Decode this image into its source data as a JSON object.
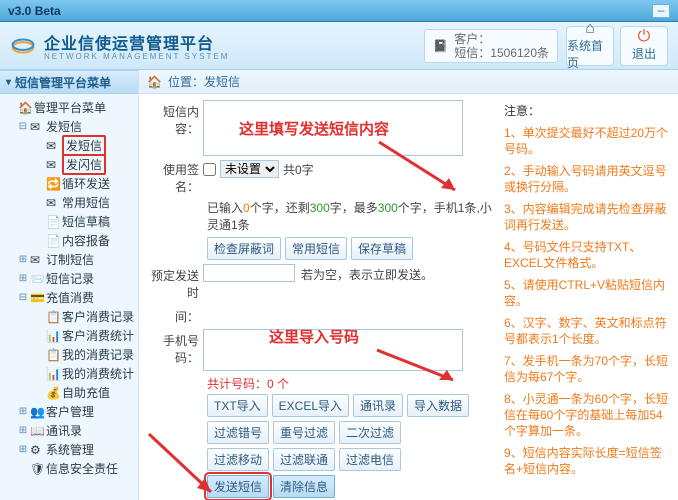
{
  "titlebar": {
    "version": "v3.0 Beta"
  },
  "header": {
    "brand": "企业信使运营管理平台",
    "brand_sub": "NETWORK  MANAGEMENT  SYSTEM",
    "cust_label": "客户：",
    "sms_label": "短信：1506120条",
    "home": "系统首页",
    "exit": "退出"
  },
  "side": {
    "title": "短信管理平台菜单",
    "nodes": [
      {
        "lvl": 0,
        "tg": "",
        "ic": "🏠",
        "lbl": "管理平台菜单"
      },
      {
        "lvl": 1,
        "tg": "⊟",
        "ic": "✉",
        "lbl": "发短信"
      },
      {
        "lvl": 2,
        "tg": "",
        "ic": "✉",
        "lbl": "发短信",
        "red": true,
        "name": "nav-send-sms"
      },
      {
        "lvl": 2,
        "tg": "",
        "ic": "✉",
        "lbl": "发闪信",
        "red": true,
        "name": "nav-send-flash"
      },
      {
        "lvl": 2,
        "tg": "",
        "ic": "🔁",
        "lbl": "循环发送"
      },
      {
        "lvl": 2,
        "tg": "",
        "ic": "✉",
        "lbl": "常用短信"
      },
      {
        "lvl": 2,
        "tg": "",
        "ic": "📄",
        "lbl": "短信草稿"
      },
      {
        "lvl": 2,
        "tg": "",
        "ic": "📄",
        "lbl": "内容报备"
      },
      {
        "lvl": 1,
        "tg": "⊞",
        "ic": "✉",
        "lbl": "订制短信"
      },
      {
        "lvl": 1,
        "tg": "⊞",
        "ic": "📨",
        "lbl": "短信记录"
      },
      {
        "lvl": 1,
        "tg": "⊟",
        "ic": "💳",
        "lbl": "充值消费"
      },
      {
        "lvl": 2,
        "tg": "",
        "ic": "📋",
        "lbl": "客户消费记录"
      },
      {
        "lvl": 2,
        "tg": "",
        "ic": "📊",
        "lbl": "客户消费统计"
      },
      {
        "lvl": 2,
        "tg": "",
        "ic": "📋",
        "lbl": "我的消费记录"
      },
      {
        "lvl": 2,
        "tg": "",
        "ic": "📊",
        "lbl": "我的消费统计"
      },
      {
        "lvl": 2,
        "tg": "",
        "ic": "💰",
        "lbl": "自助充值"
      },
      {
        "lvl": 1,
        "tg": "⊞",
        "ic": "👥",
        "lbl": "客户管理"
      },
      {
        "lvl": 1,
        "tg": "⊞",
        "ic": "📖",
        "lbl": "通讯录"
      },
      {
        "lvl": 1,
        "tg": "⊞",
        "ic": "⚙",
        "lbl": "系统管理"
      },
      {
        "lvl": 1,
        "tg": "",
        "ic": "🛡",
        "lbl": "信息安全责任"
      }
    ]
  },
  "crumb": {
    "icon": "🏠",
    "label": "位置：发短信"
  },
  "form": {
    "content_label": "短信内容：",
    "sig_label": "使用签名：",
    "sig_select": "未设置",
    "sig_count": "共0字",
    "typed_a": "已输入",
    "typed_b": "个字，还剩",
    "typed_c": "字，最多",
    "typed_d": "个字，手机1条,小灵通1条",
    "n0": "0",
    "n300a": "300",
    "n300b": "300",
    "btn_check": "检查屏蔽词",
    "btn_common": "常用短信",
    "btn_draft": "保存草稿",
    "sched_label": "预定发送时",
    "sched_tip": "若为空，表示立即发送。",
    "gap_label": "间：",
    "phone_label": "手机号码：",
    "count_label": "共计号码：0 个",
    "b_txt": "TXT导入",
    "b_excel": "EXCEL导入",
    "b_book": "通讯录",
    "b_data": "导入数据",
    "b_ferr": "过滤错号",
    "b_fdup": "重号过滤",
    "b_f2": "二次过滤",
    "b_fmob": "过滤移动",
    "b_funi": "过滤联通",
    "b_ftel": "过滤电信",
    "b_send": "发送短信",
    "b_clear": "清除信息"
  },
  "anno": {
    "a1": "这里填写发送短信内容",
    "a2": "这里导入号码"
  },
  "notes": {
    "title": "注意：",
    "items": [
      "1、单次提交最好不超过20万个号码。",
      "2、手动输入号码请用英文逗号或换行分隔。",
      "3、内容编辑完成请先检查屏蔽词再行发送。",
      "4、号码文件只支持TXT、EXCEL文件格式。",
      "5、请使用CTRL+V粘贴短信内容。",
      "6、汉字、数字、英文和标点符号都表示1个长度。",
      "7、发手机一条为70个字，长短信为每67个字。",
      "8、小灵通一条为60个字，长短信在每60个字的基础上每加54个字算加一条。",
      "9、短信内容实际长度=短信签名+短信内容。"
    ]
  }
}
